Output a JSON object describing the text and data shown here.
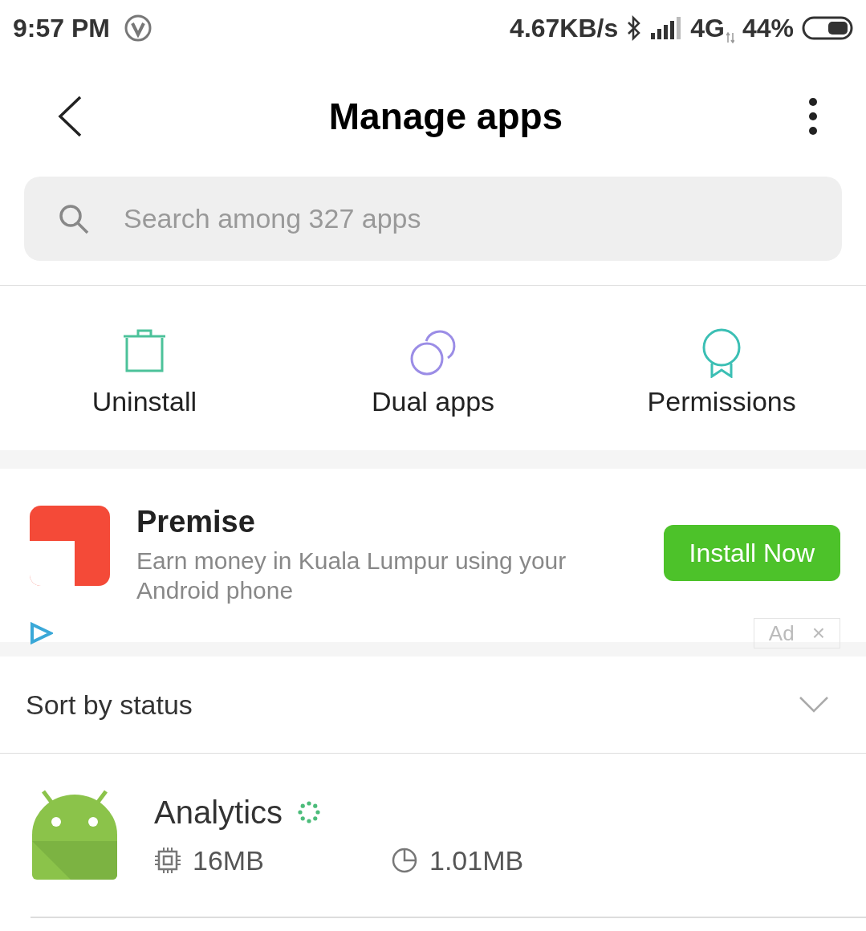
{
  "status_bar": {
    "time": "9:57 PM",
    "speed": "4.67KB/s",
    "network": "4G",
    "battery": "44%"
  },
  "header": {
    "title": "Manage apps"
  },
  "search": {
    "placeholder": "Search among 327 apps"
  },
  "actions": [
    {
      "kind": "trash",
      "label": "Uninstall"
    },
    {
      "kind": "dual",
      "label": "Dual apps"
    },
    {
      "kind": "badge",
      "label": "Permissions"
    }
  ],
  "ad": {
    "title": "Premise",
    "description": "Earn money in Kuala Lumpur using your Android phone",
    "button": "Install Now",
    "tag": "Ad",
    "close": "×"
  },
  "sort": {
    "label": "Sort by status"
  },
  "apps": [
    {
      "name": "Analytics",
      "memory": "16MB",
      "storage": "1.01MB",
      "loading": true
    }
  ]
}
